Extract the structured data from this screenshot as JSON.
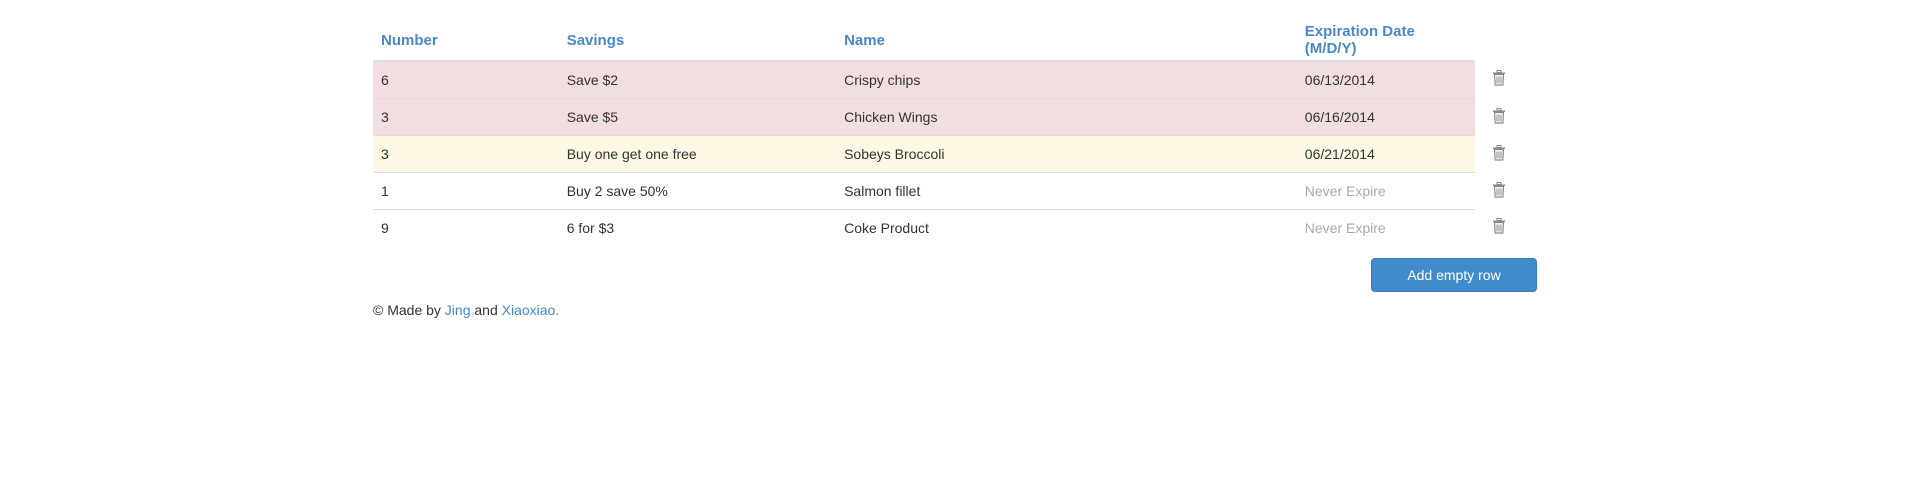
{
  "table": {
    "headers": {
      "number": "Number",
      "savings": "Savings",
      "name": "Name",
      "expiration": "Expiration Date (M/D/Y)"
    },
    "rows": [
      {
        "number": "6",
        "savings": "Save $2",
        "name": "Crispy chips",
        "expiration": "06/13/2014",
        "status": "danger"
      },
      {
        "number": "3",
        "savings": "Save $5",
        "name": "Chicken Wings",
        "expiration": "06/16/2014",
        "status": "danger"
      },
      {
        "number": "3",
        "savings": "Buy one get one free",
        "name": "Sobeys Broccoli",
        "expiration": "06/21/2014",
        "status": "warning"
      },
      {
        "number": "1",
        "savings": "Buy 2 save 50%",
        "name": "Salmon fillet",
        "expiration": "Never Expire",
        "status": "never"
      },
      {
        "number": "9",
        "savings": "6 for $3",
        "name": "Coke Product",
        "expiration": "Never Expire",
        "status": "never"
      }
    ],
    "delete_icon": "trash-icon"
  },
  "actions": {
    "add_row_label": "Add empty row"
  },
  "footer": {
    "prefix": "© Made by ",
    "author1": "Jing",
    "conjunction": " and ",
    "author2": "Xiaoxiao",
    "suffix": "."
  },
  "colors": {
    "accent": "#428bca",
    "header_text": "#4a89c8",
    "danger_row": "#f2dede",
    "warning_row": "#fcf8e3",
    "muted_text": "#aaaaaa"
  }
}
